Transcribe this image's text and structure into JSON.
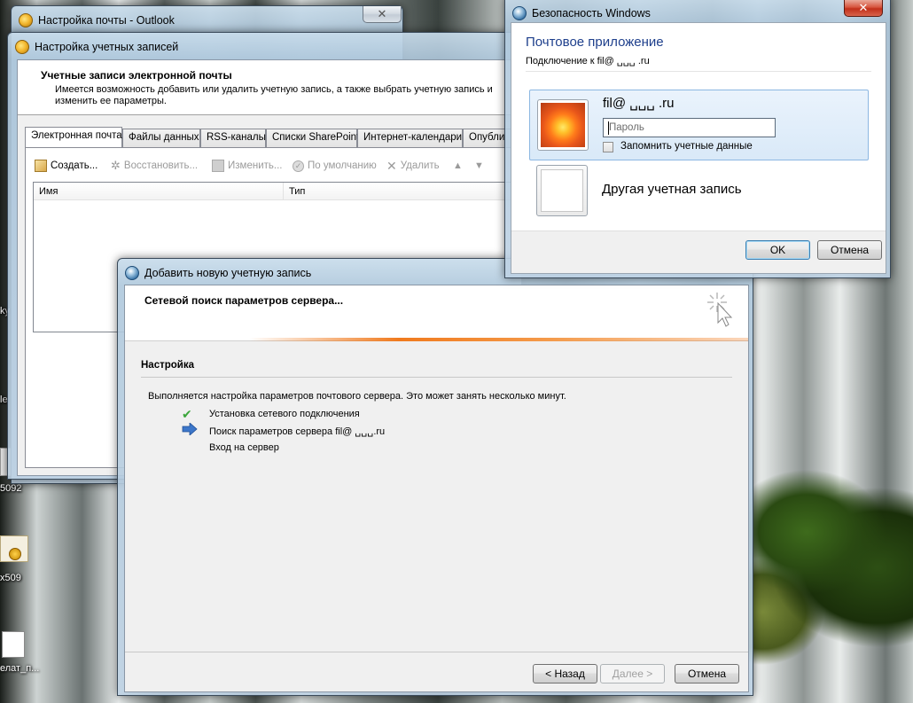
{
  "desktop": {
    "icons": [
      {
        "label": "5092"
      },
      {
        "label": "x509"
      },
      {
        "label": "елат_п..."
      }
    ],
    "side_fragments": [
      "с",
      "ky",
      "le"
    ]
  },
  "outlook_window": {
    "title": "Настройка почты - Outlook"
  },
  "accounts_window": {
    "title": "Настройка учетных записей",
    "header_title": "Учетные записи электронной почты",
    "header_desc": "Имеется возможность добавить или удалить учетную запись, а также выбрать учетную запись и изменить ее параметры.",
    "tabs": [
      {
        "label": "Электронная почта",
        "active": true
      },
      {
        "label": "Файлы данных",
        "active": false
      },
      {
        "label": "RSS-каналы",
        "active": false
      },
      {
        "label": "Списки SharePoint",
        "active": false
      },
      {
        "label": "Интернет-календари",
        "active": false
      },
      {
        "label": "Опубли",
        "active": false
      }
    ],
    "toolbar": {
      "create": "Создать...",
      "repair": "Восстановить...",
      "change": "Изменить...",
      "default": "По умолчанию",
      "delete": "Удалить"
    },
    "columns": [
      "Имя",
      "Тип"
    ]
  },
  "add_account_window": {
    "title": "Добавить новую учетную запись",
    "banner_title": "Сетевой поиск параметров сервера...",
    "section_title": "Настройка",
    "status_text": "Выполняется настройка параметров почтового сервера. Это может занять несколько минут.",
    "steps": [
      {
        "label": "Установка сетевого подключения",
        "state": "done"
      },
      {
        "label": "Поиск параметров сервера fil@ ␣␣␣.ru",
        "state": "current"
      },
      {
        "label": "Вход на сервер",
        "state": "pending"
      }
    ],
    "buttons": {
      "back": "< Назад",
      "next": "Далее >",
      "cancel": "Отмена"
    }
  },
  "security_window": {
    "title": "Безопасность Windows",
    "app_title": "Почтовое приложение",
    "connect_text": "Подключение к fil@ ␣␣␣ .ru",
    "account_user": "fil@ ␣␣␣ .ru",
    "password_placeholder": "Пароль",
    "remember_label": "Запомнить учетные данные",
    "other_account": "Другая учетная запись",
    "buttons": {
      "ok": "OK",
      "cancel": "Отмена"
    }
  }
}
